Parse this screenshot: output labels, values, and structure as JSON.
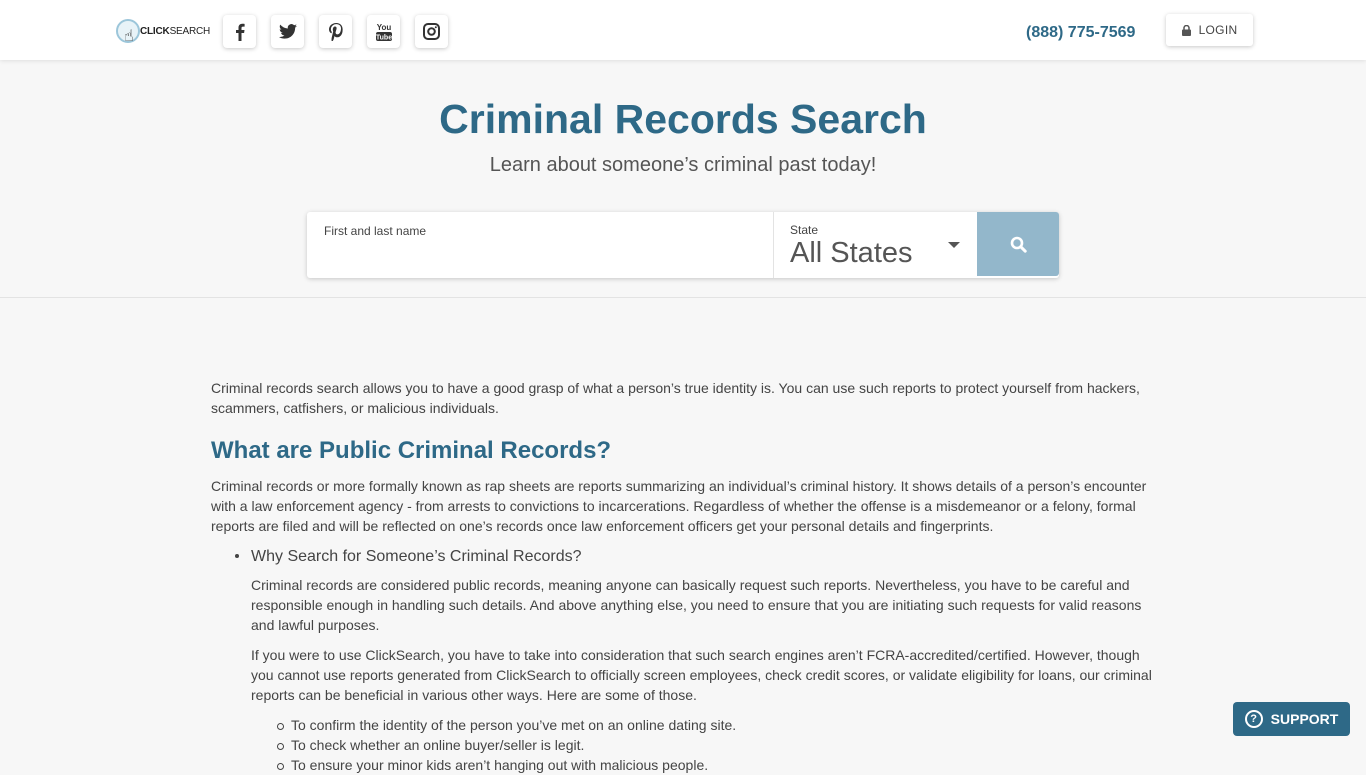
{
  "header": {
    "logo": {
      "brand_prefix": "CLICK",
      "brand_suffix": "SEARCH"
    },
    "social": [
      {
        "name": "facebook-icon",
        "glyph": "f"
      },
      {
        "name": "twitter-icon",
        "glyph": "bird"
      },
      {
        "name": "pinterest-icon",
        "glyph": "p"
      },
      {
        "name": "youtube-icon",
        "glyph": "You Tube"
      },
      {
        "name": "instagram-icon",
        "glyph": "camera"
      }
    ],
    "phone": "(888) 775-7569",
    "login_label": "LOGIN"
  },
  "hero": {
    "title": "Criminal Records Search",
    "subtitle": "Learn about someone’s criminal past today!",
    "search": {
      "name_label": "First and last name",
      "name_value": "",
      "state_label": "State",
      "state_value": "All States"
    }
  },
  "content": {
    "intro": "Criminal records search allows you to have a good grasp of what a person’s true identity is. You can use such reports to protect yourself from hackers, scammers, catfishers, or malicious individuals.",
    "heading": "What are Public Criminal Records?",
    "paragraph": "Criminal records or more formally known as rap sheets are reports summarizing an individual’s criminal history. It shows details of a person’s encounter with a law enforcement agency - from arrests to convictions to incarcerations. Regardless of whether the offense is a misdemeanor or a felony, formal reports are filed and will be reflected on one’s records once law enforcement officers get your personal details and fingerprints.",
    "bullet_title": "Why Search for Someone’s Criminal Records?",
    "bullet_p1": "Criminal records are considered public records, meaning anyone can basically request such reports. Nevertheless, you have to be careful and responsible enough in handling such details. And above anything else, you need to ensure that you are initiating such requests for valid reasons and lawful purposes.",
    "bullet_p2": "If you were to use ClickSearch, you have to take into consideration that such search engines aren’t FCRA-accredited/certified. However, though you cannot use reports generated from ClickSearch to officially screen employees, check credit scores, or validate eligibility for loans, our criminal reports can be beneficial in various other ways. Here are some of those.",
    "sub_items": [
      "To confirm the identity of the person you’ve met on an online dating site.",
      "To check whether an online buyer/seller is legit.",
      "To ensure your minor kids aren’t hanging out with malicious people."
    ]
  },
  "support_label": "SUPPORT",
  "colors": {
    "brand": "#2e6987",
    "search_button": "#93b7cb",
    "background": "#f7f7f7"
  }
}
